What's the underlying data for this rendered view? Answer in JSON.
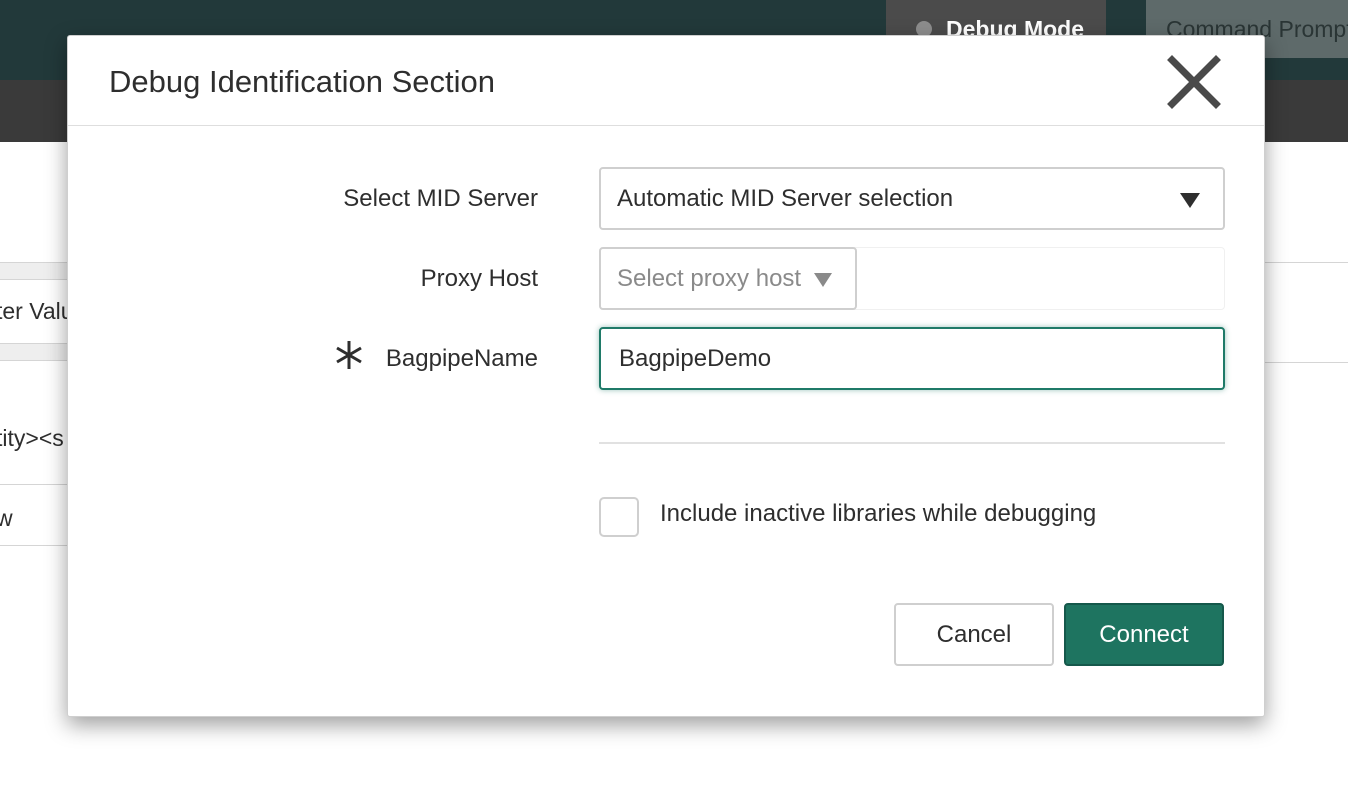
{
  "background": {
    "tabs": [
      {
        "label": "Debug Mode"
      },
      {
        "label": "Command Prompt"
      }
    ],
    "left_cells": [
      "ter Value",
      "tity><s",
      "w"
    ]
  },
  "modal": {
    "title": "Debug Identification Section",
    "close_icon": "close-icon",
    "fields": {
      "mid_server": {
        "label": "Select MID Server",
        "value": "Automatic MID Server selection"
      },
      "proxy_host": {
        "label": "Proxy Host",
        "placeholder": "Select proxy host"
      },
      "bagpipe_name": {
        "label": "BagpipeName",
        "value": "BagpipeDemo",
        "required": true
      }
    },
    "checkbox": {
      "label": "Include inactive libraries while debugging",
      "checked": false
    },
    "buttons": {
      "cancel": "Cancel",
      "connect": "Connect"
    }
  },
  "colors": {
    "primary": "#1e7460",
    "topbar": "#22393a",
    "subbar": "#3a3a3a"
  }
}
